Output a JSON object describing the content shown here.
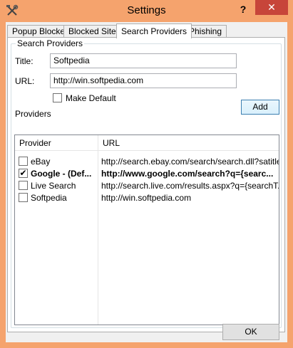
{
  "window": {
    "title": "Settings",
    "help_label": "?",
    "close_label": "✕"
  },
  "tabs": [
    {
      "label": "Popup Blocker"
    },
    {
      "label": "Blocked Sites"
    },
    {
      "label": "Search Providers"
    },
    {
      "label": "Phishing"
    }
  ],
  "search_providers": {
    "group_title": "Search Providers",
    "title_label": "Title:",
    "title_value": "Softpedia",
    "url_label": "URL:",
    "url_value": "http://win.softpedia.com",
    "make_default_label": "Make Default",
    "add_label": "Add",
    "providers_label": "Providers",
    "list": {
      "columns": [
        "Provider",
        "URL"
      ],
      "rows": [
        {
          "checked": "",
          "provider": "eBay",
          "url": "http://search.ebay.com/search/search.dll?satitle..."
        },
        {
          "checked": "✔",
          "provider": "Google - (Def...",
          "url": "http://www.google.com/search?q={searc..."
        },
        {
          "checked": "",
          "provider": "Live Search",
          "url": "http://search.live.com/results.aspx?q={searchT..."
        },
        {
          "checked": "",
          "provider": "Softpedia",
          "url": "http://win.softpedia.com"
        }
      ]
    }
  },
  "ok_label": "OK"
}
